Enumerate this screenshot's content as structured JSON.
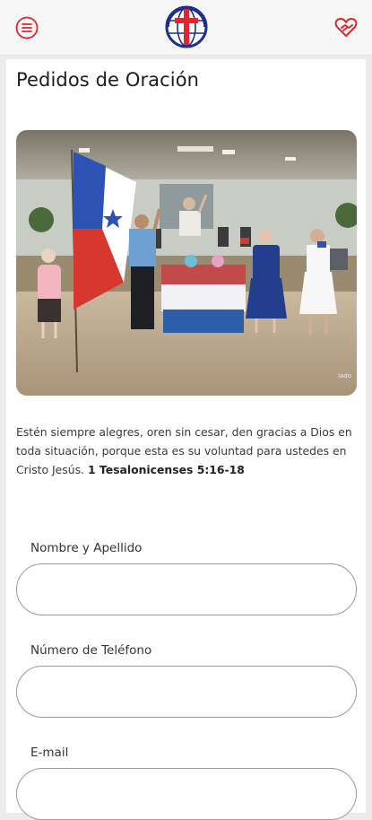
{
  "header": {
    "menu_icon": "hamburger-menu-icon",
    "logo": "church-cross-globe-logo",
    "action_icon": "prayer-heart-hands-icon",
    "accent_color": "#e0262d",
    "logo_blue": "#1c2f8c"
  },
  "page": {
    "title": "Pedidos de Oración"
  },
  "photo": {
    "caption": "lado"
  },
  "verse": {
    "text": "Estén siempre alegres, oren sin cesar, den gracias a Dios en toda situación, porque esta es su voluntad para ustedes en Cristo Jesús. ",
    "reference": "1 Tesalonicenses 5:16-18"
  },
  "form": {
    "name_label": "Nombre y Apellido",
    "name_value": "",
    "phone_label": "Número de Teléfono",
    "phone_value": "",
    "email_label": "E-mail",
    "email_value": ""
  }
}
